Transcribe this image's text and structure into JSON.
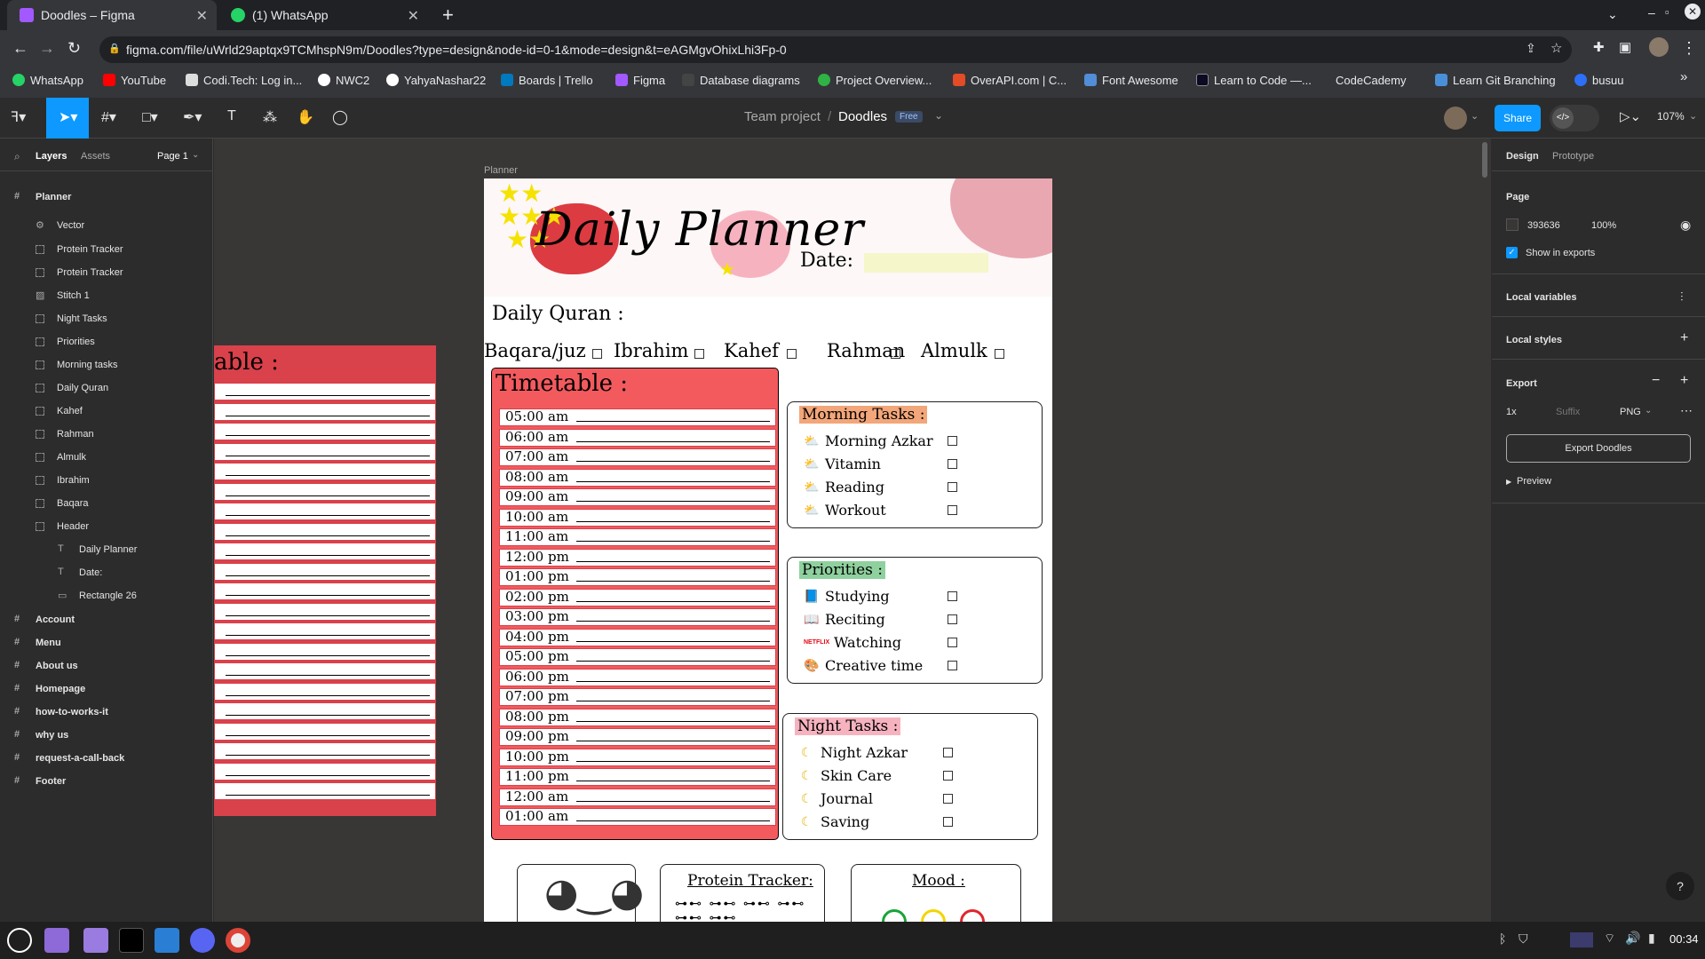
{
  "browser": {
    "tabs": [
      {
        "title": "Doodles – Figma",
        "icon": "figma-icon",
        "active": true
      },
      {
        "title": "(1) WhatsApp",
        "icon": "whatsapp-icon",
        "active": false
      }
    ],
    "new_tab": "+",
    "url": "figma.com/file/uWrld29aptqx9TCMhspN9m/Doodles?type=design&node-id=0-1&mode=design&t=eAGMgvOhixLhi3Fp-0",
    "bookmarks": [
      "WhatsApp",
      "YouTube",
      "Codi.Tech: Log in...",
      "NWC2",
      "YahyaNashar22",
      "Boards | Trello",
      "Figma",
      "Database diagrams",
      "Project Overview...",
      "OverAPI.com | C...",
      "Font Awesome",
      "Learn to Code —...",
      "CodeCademy",
      "Learn Git Branching",
      "busuu"
    ]
  },
  "figma": {
    "breadcrumb_team": "Team project",
    "separator": "/",
    "file_name": "Doodles",
    "plan_badge": "Free",
    "share_label": "Share",
    "zoom": "107%",
    "left_tabs": [
      "Layers",
      "Assets"
    ],
    "page_selector": "Page 1",
    "layers": [
      {
        "name": "Planner",
        "type": "frame"
      },
      {
        "name": "Vector",
        "type": "vector"
      },
      {
        "name": "Protein Tracker",
        "type": "group"
      },
      {
        "name": "Protein Tracker",
        "type": "group"
      },
      {
        "name": "Stitch 1",
        "type": "image"
      },
      {
        "name": "Night Tasks",
        "type": "group"
      },
      {
        "name": "Priorities",
        "type": "group"
      },
      {
        "name": "Morning tasks",
        "type": "group"
      },
      {
        "name": "Daily Quran",
        "type": "group"
      },
      {
        "name": "Kahef",
        "type": "group"
      },
      {
        "name": "Rahman",
        "type": "group"
      },
      {
        "name": "Almulk",
        "type": "group"
      },
      {
        "name": "Ibrahim",
        "type": "group"
      },
      {
        "name": "Baqara",
        "type": "group"
      },
      {
        "name": "Header",
        "type": "group"
      },
      {
        "name": "Daily Planner",
        "type": "text"
      },
      {
        "name": "Date:",
        "type": "text"
      },
      {
        "name": "Rectangle 26",
        "type": "rect"
      },
      {
        "name": "Account",
        "type": "frame"
      },
      {
        "name": "Menu",
        "type": "frame"
      },
      {
        "name": "About us",
        "type": "frame"
      },
      {
        "name": "Homepage",
        "type": "frame"
      },
      {
        "name": "how-to-works-it",
        "type": "frame"
      },
      {
        "name": "why us",
        "type": "frame"
      },
      {
        "name": "request-a-call-back",
        "type": "frame"
      },
      {
        "name": "Footer",
        "type": "frame"
      }
    ],
    "right_tabs": [
      "Design",
      "Prototype"
    ],
    "page_section": "Page",
    "page_color": "393636",
    "page_opacity": "100%",
    "show_in_exports": "Show in exports",
    "local_variables": "Local variables",
    "local_styles": "Local styles",
    "export_title": "Export",
    "export_scale": "1x",
    "export_suffix_placeholder": "Suffix",
    "export_format": "PNG",
    "export_button": "Export Doodles",
    "preview_label": "Preview",
    "help": "?"
  },
  "canvas": {
    "frame_label": "Planner",
    "ghost_title": "able :",
    "page_bg": "#393636"
  },
  "planner": {
    "title": "Daily Planner",
    "date_label": "Date:",
    "quran_title": "Daily Quran :",
    "surahs": [
      "Baqara/juz",
      "Ibrahim",
      "Kahef",
      "Rahman",
      "Almulk"
    ],
    "timetable_title": "Timetable :",
    "times": [
      "05:00 am",
      "06:00 am",
      "07:00 am",
      "08:00 am",
      "09:00 am",
      "10:00 am",
      "11:00 am",
      "12:00 pm",
      "01:00 pm",
      "02:00 pm",
      "03:00 pm",
      "04:00 pm",
      "05:00 pm",
      "06:00 pm",
      "07:00 pm",
      "08:00 pm",
      "09:00 pm",
      "10:00 pm",
      "11:00 pm",
      "12:00 am",
      "01:00 am"
    ],
    "morning": {
      "title": "Morning Tasks :",
      "items": [
        "Morning Azkar",
        "Vitamin",
        "Reading",
        "Workout"
      ]
    },
    "priorities": {
      "title": "Priorities :",
      "items": [
        "Studying",
        "Reciting",
        "Watching",
        "Creative time"
      ]
    },
    "night": {
      "title": "Night Tasks :",
      "items": [
        "Night Azkar",
        "Skin Care",
        "Journal",
        "Saving"
      ]
    },
    "netflix_label": "NETFLIX",
    "protein_title": "Protein Tracker:",
    "mood_title": "Mood :",
    "colors": {
      "timetable": "#f25a5e",
      "timetable_border": "#d9414b",
      "morning": "#f2a679",
      "priorities": "#8fd19e",
      "night": "#f6b3bf",
      "date_box": "#f5f6c9"
    }
  },
  "taskbar": {
    "clock": "00:34"
  }
}
